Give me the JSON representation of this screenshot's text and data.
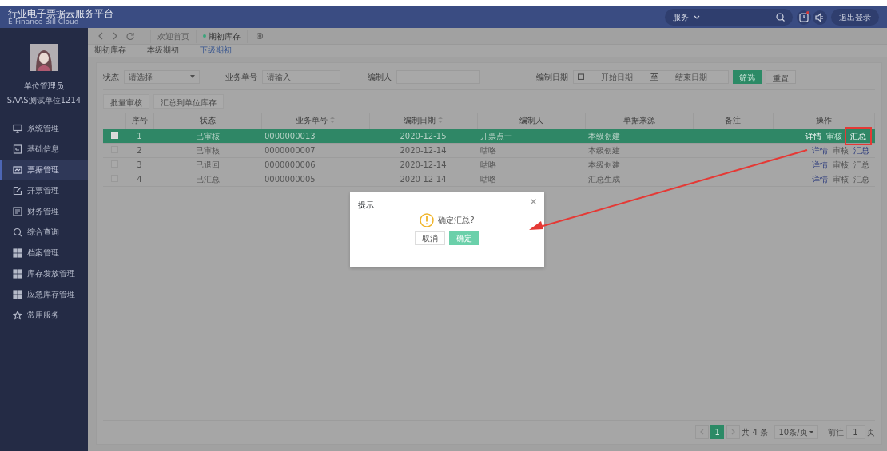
{
  "header": {
    "title": "行业电子票据云服务平台",
    "subtitle": "E-Finance Bill Cloud",
    "service_menu": "服务",
    "logout": "退出登录",
    "notification": true
  },
  "user": {
    "name": "单位管理员",
    "org": "SAAS测试单位1214"
  },
  "sidebar": {
    "items": [
      {
        "label": "系统管理",
        "selected": false
      },
      {
        "label": "基础信息",
        "selected": false
      },
      {
        "label": "票据管理",
        "selected": true
      },
      {
        "label": "开票管理",
        "selected": false
      },
      {
        "label": "财务管理",
        "selected": false
      },
      {
        "label": "综合查询",
        "selected": false
      },
      {
        "label": "档案管理",
        "selected": false
      },
      {
        "label": "库存发放管理",
        "selected": false
      },
      {
        "label": "应急库存管理",
        "selected": false
      },
      {
        "label": "常用服务",
        "selected": false
      }
    ]
  },
  "page_tabs": [
    {
      "label": "欢迎首页",
      "selected": false
    },
    {
      "label": "期初库存",
      "selected": true
    }
  ],
  "sub_tabs": [
    {
      "label": "期初库存",
      "selected": false
    },
    {
      "label": "本级期初",
      "selected": false
    },
    {
      "label": "下级期初",
      "selected": true
    }
  ],
  "filters": {
    "status_label": "状态",
    "status_placeholder": "请选择",
    "number_label": "业务单号",
    "number_placeholder": "请输入",
    "creator_label": "编制人",
    "date_label": "编制日期",
    "date_start_placeholder": "开始日期",
    "date_separator": "至",
    "date_end_placeholder": "结束日期",
    "filter_button": "筛选",
    "reset_button": "重置"
  },
  "toolbar": [
    {
      "label": "批量审核",
      "disabled": true
    },
    {
      "label": "汇总到单位库存",
      "disabled": true
    }
  ],
  "table": {
    "columns": [
      "序号",
      "状态",
      "业务单号",
      "编制日期",
      "编制人",
      "单据来源",
      "备注",
      "操作"
    ],
    "rows": [
      {
        "selected": true,
        "checked": true,
        "cells": [
          "1",
          "已审核",
          "0000000013",
          "2020-12-15",
          "开票点一",
          "本级创建"
        ],
        "actions": [
          {
            "label": "详情",
            "disabled": false
          },
          {
            "label": "审核",
            "disabled": true
          },
          {
            "label": "汇总",
            "disabled": false,
            "highlighted": true
          }
        ]
      },
      {
        "selected": false,
        "checked": false,
        "cells": [
          "2",
          "已审核",
          "0000000007",
          "2020-12-14",
          "咕咯",
          "本级创建"
        ],
        "actions": [
          {
            "label": "详情",
            "disabled": false
          },
          {
            "label": "审核",
            "disabled": true
          },
          {
            "label": "汇总",
            "disabled": false
          }
        ]
      },
      {
        "selected": false,
        "checked": false,
        "cells": [
          "3",
          "已退回",
          "0000000006",
          "2020-12-14",
          "咕咯",
          "本级创建"
        ],
        "actions": [
          {
            "label": "详情",
            "disabled": false
          },
          {
            "label": "审核",
            "disabled": true
          },
          {
            "label": "汇总",
            "disabled": true
          }
        ]
      },
      {
        "selected": false,
        "checked": false,
        "cells": [
          "4",
          "已汇总",
          "0000000005",
          "2020-12-14",
          "咕咯",
          "汇总生成"
        ],
        "actions": [
          {
            "label": "详情",
            "disabled": false
          },
          {
            "label": "审核",
            "disabled": true
          },
          {
            "label": "汇总",
            "disabled": true
          }
        ]
      }
    ]
  },
  "pagination": {
    "pages": [
      {
        "label": "1",
        "selected": true
      }
    ],
    "total": "共 4 条",
    "page_size": "10条/页",
    "goto_label": "前往",
    "goto_value": "1",
    "page_unit": "页"
  },
  "dialog": {
    "title": "提示",
    "message": "确定汇总?",
    "cancel": "取消",
    "confirm": "确定"
  }
}
